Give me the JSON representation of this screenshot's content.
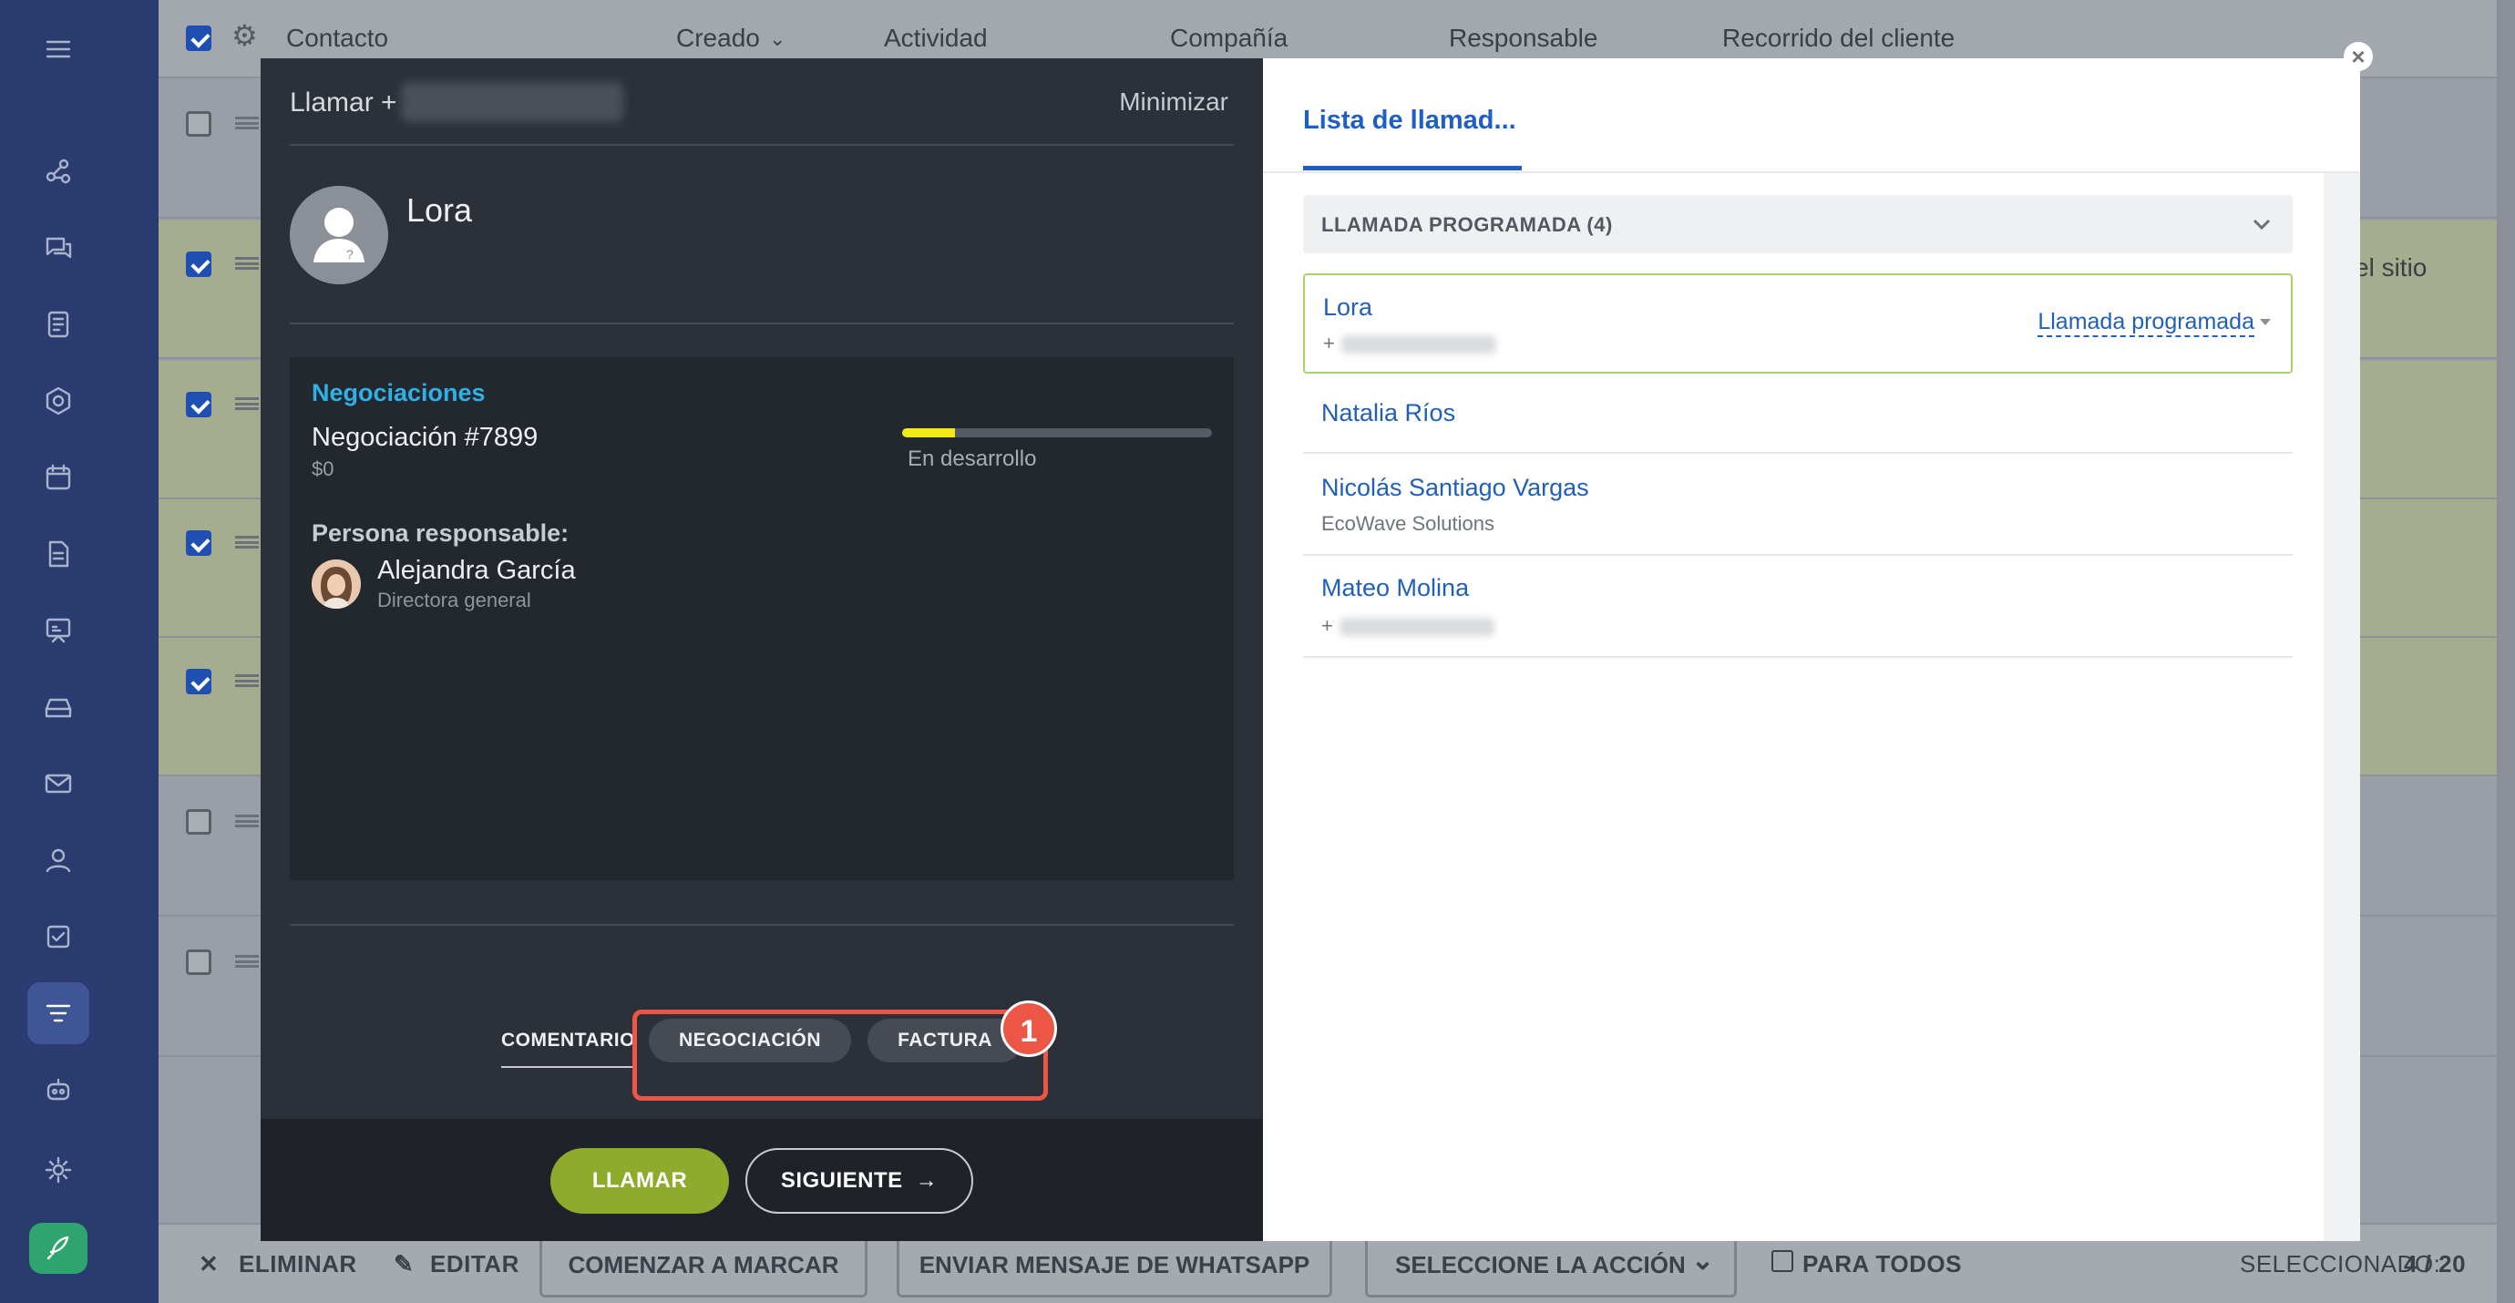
{
  "background_list": {
    "columns": [
      "Contacto",
      "Creado",
      "Actividad",
      "Compañía",
      "Responsable",
      "Recorrido del cliente"
    ],
    "row_snippet": "el sitio",
    "action_bar": {
      "delete": "ELIMINAR",
      "edit": "EDITAR",
      "start_dial": "COMENZAR A MARCAR",
      "whatsapp": "ENVIAR MENSAJE DE WHATSAPP",
      "select_action": "SELECCIONE LA ACCIÓN",
      "for_all": "PARA TODOS",
      "selected_label": "SELECCIONADO:",
      "selected_count": "4 / 20"
    }
  },
  "call_dialog": {
    "title_prefix": "Llamar +",
    "minimize": "Minimizar",
    "contact_name": "Lora",
    "deals": {
      "heading": "Negociaciones",
      "deal_name": "Negociación #7899",
      "amount": "$0",
      "stage": "En desarrollo",
      "progress_fraction": 0.17,
      "progress_color": "#f2ea17"
    },
    "responsible": {
      "heading": "Persona responsable:",
      "name": "Alejandra García",
      "role": "Directora general"
    },
    "tabs": {
      "comment": "COMENTARIO",
      "deal": "NEGOCIACIÓN",
      "invoice": "FACTURA"
    },
    "highlight_badge": "1",
    "buttons": {
      "call": "LLAMAR",
      "next": "SIGUIENTE"
    }
  },
  "call_list": {
    "tab": "Lista de llamad...",
    "group_header": "LLAMADA PROGRAMADA (4)",
    "items": [
      {
        "name": "Lora",
        "sub": "+",
        "status": "Llamada programada"
      },
      {
        "name": "Natalia Ríos",
        "sub": ""
      },
      {
        "name": "Nicolás Santiago Vargas",
        "sub": "EcoWave Solutions"
      },
      {
        "name": "Mateo Molina",
        "sub": "+"
      }
    ]
  },
  "colors": {
    "accent_blue": "#1f5fc4",
    "call_green": "#8fab2c",
    "highlight_red": "#ec5646"
  }
}
